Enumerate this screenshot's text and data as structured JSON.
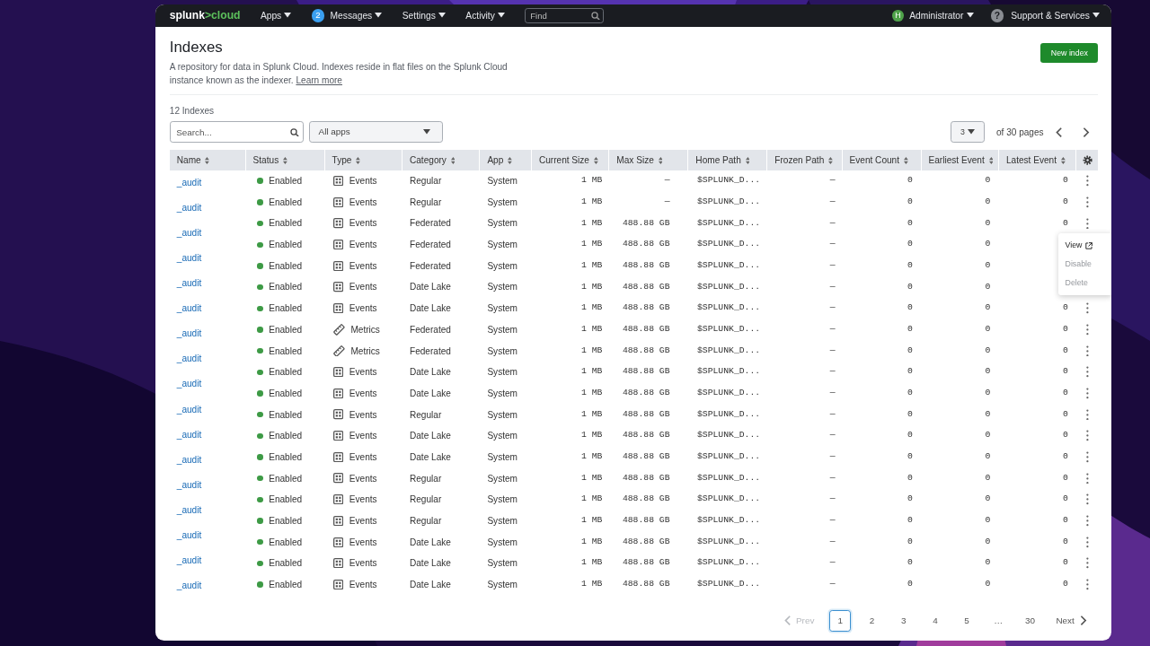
{
  "nav": {
    "logo": [
      "splunk",
      ">cloud"
    ],
    "items": [
      {
        "label": "Apps"
      },
      {
        "label": "Messages",
        "badge": "2"
      },
      {
        "label": "Settings"
      },
      {
        "label": "Activity"
      }
    ],
    "find": {
      "placeholder": "Find"
    },
    "user": {
      "avatar": "H",
      "label": "Administrator"
    },
    "support": {
      "icon": "?",
      "label": "Support & Services"
    }
  },
  "page": {
    "title": "Indexes",
    "description": "A repository for data in Splunk Cloud. Indexes reside in flat files on the Splunk Cloud instance known as the indexer.",
    "learn_more": "Learn more",
    "new_button": "New index"
  },
  "count": "12 Indexes",
  "search": {
    "placeholder": "Search..."
  },
  "app_filter": {
    "value": "All apps"
  },
  "pager_top": {
    "page": "3",
    "of": "of 30 pages"
  },
  "table": {
    "columns": [
      "Name",
      "Status",
      "Type",
      "Category",
      "App",
      "Current Size",
      "Max Size",
      "Home Path",
      "Frozen Path",
      "Event Count",
      "Earliest Event",
      "Latest Event"
    ],
    "names": [
      "_audit",
      "_audit",
      "_audit",
      "_audit",
      "_audit",
      "_audit",
      "_audit",
      "_audit",
      "_audit",
      "_audit",
      "_audit",
      "_audit",
      "_audit",
      "_audit",
      "_audit",
      "_audit",
      "_audit"
    ],
    "row_menu": [
      {
        "label": "View",
        "disabled": false
      },
      {
        "label": "Disable",
        "disabled": true
      },
      {
        "label": "Delete",
        "disabled": true
      }
    ],
    "rows": [
      {
        "status": "Enabled",
        "kind": "events",
        "type": "Events",
        "category": "Regular",
        "app": "System",
        "current_size": "1 MB",
        "max_size": "—",
        "home_path": "$SPLUNK_D...",
        "frozen_path": "—",
        "event_count": "0",
        "earliest": "0",
        "latest": "0",
        "menu_open": false
      },
      {
        "status": "Enabled",
        "kind": "events",
        "type": "Events",
        "category": "Regular",
        "app": "System",
        "current_size": "1 MB",
        "max_size": "—",
        "home_path": "$SPLUNK_D...",
        "frozen_path": "—",
        "event_count": "0",
        "earliest": "0",
        "latest": "0",
        "menu_open": false
      },
      {
        "status": "Enabled",
        "kind": "events",
        "type": "Events",
        "category": "Federated",
        "app": "System",
        "current_size": "1 MB",
        "max_size": "488.88 GB",
        "home_path": "$SPLUNK_D...",
        "frozen_path": "—",
        "event_count": "0",
        "earliest": "0",
        "latest": "0",
        "menu_open": true
      },
      {
        "status": "Enabled",
        "kind": "events",
        "type": "Events",
        "category": "Federated",
        "app": "System",
        "current_size": "1 MB",
        "max_size": "488.88 GB",
        "home_path": "$SPLUNK_D...",
        "frozen_path": "—",
        "event_count": "0",
        "earliest": "0",
        "menu_open": false
      },
      {
        "status": "Enabled",
        "kind": "events",
        "type": "Events",
        "category": "Federated",
        "app": "System",
        "current_size": "1 MB",
        "max_size": "488.88 GB",
        "home_path": "$SPLUNK_D...",
        "frozen_path": "—",
        "event_count": "0",
        "earliest": "0",
        "menu_open": false
      },
      {
        "status": "Enabled",
        "kind": "events",
        "type": "Events",
        "category": "Date Lake",
        "app": "System",
        "current_size": "1 MB",
        "max_size": "488.88 GB",
        "home_path": "$SPLUNK_D...",
        "frozen_path": "—",
        "event_count": "0",
        "earliest": "0",
        "menu_open": false
      },
      {
        "status": "Enabled",
        "kind": "events",
        "type": "Events",
        "category": "Date Lake",
        "app": "System",
        "current_size": "1 MB",
        "max_size": "488.88 GB",
        "home_path": "$SPLUNK_D...",
        "frozen_path": "—",
        "event_count": "0",
        "earliest": "0",
        "latest": "0",
        "menu_open": false
      },
      {
        "status": "Enabled",
        "kind": "metrics",
        "type": "Metrics",
        "category": "Federated",
        "app": "System",
        "current_size": "1 MB",
        "max_size": "488.88 GB",
        "home_path": "$SPLUNK_D...",
        "frozen_path": "—",
        "event_count": "0",
        "earliest": "0",
        "latest": "0",
        "menu_open": false
      },
      {
        "status": "Enabled",
        "kind": "metrics",
        "type": "Metrics",
        "category": "Federated",
        "app": "System",
        "current_size": "1 MB",
        "max_size": "488.88 GB",
        "home_path": "$SPLUNK_D...",
        "frozen_path": "—",
        "event_count": "0",
        "earliest": "0",
        "latest": "0",
        "menu_open": false
      },
      {
        "status": "Enabled",
        "kind": "events",
        "type": "Events",
        "category": "Date Lake",
        "app": "System",
        "current_size": "1 MB",
        "max_size": "488.88 GB",
        "home_path": "$SPLUNK_D...",
        "frozen_path": "—",
        "event_count": "0",
        "earliest": "0",
        "latest": "0",
        "menu_open": false
      },
      {
        "status": "Enabled",
        "kind": "events",
        "type": "Events",
        "category": "Date Lake",
        "app": "System",
        "current_size": "1 MB",
        "max_size": "488.88 GB",
        "home_path": "$SPLUNK_D...",
        "frozen_path": "—",
        "event_count": "0",
        "earliest": "0",
        "latest": "0",
        "menu_open": false
      },
      {
        "status": "Enabled",
        "kind": "events",
        "type": "Events",
        "category": "Regular",
        "app": "System",
        "current_size": "1 MB",
        "max_size": "488.88 GB",
        "home_path": "$SPLUNK_D...",
        "frozen_path": "—",
        "event_count": "0",
        "earliest": "0",
        "latest": "0",
        "menu_open": false
      },
      {
        "status": "Enabled",
        "kind": "events",
        "type": "Events",
        "category": "Date Lake",
        "app": "System",
        "current_size": "1 MB",
        "max_size": "488.88 GB",
        "home_path": "$SPLUNK_D...",
        "frozen_path": "—",
        "event_count": "0",
        "earliest": "0",
        "latest": "0",
        "menu_open": false
      },
      {
        "status": "Enabled",
        "kind": "events",
        "type": "Events",
        "category": "Date Lake",
        "app": "System",
        "current_size": "1 MB",
        "max_size": "488.88 GB",
        "home_path": "$SPLUNK_D...",
        "frozen_path": "—",
        "event_count": "0",
        "earliest": "0",
        "latest": "0",
        "menu_open": false
      },
      {
        "status": "Enabled",
        "kind": "events",
        "type": "Events",
        "category": "Regular",
        "app": "System",
        "current_size": "1 MB",
        "max_size": "488.88 GB",
        "home_path": "$SPLUNK_D...",
        "frozen_path": "—",
        "event_count": "0",
        "earliest": "0",
        "latest": "0",
        "menu_open": false
      },
      {
        "status": "Enabled",
        "kind": "events",
        "type": "Events",
        "category": "Regular",
        "app": "System",
        "current_size": "1 MB",
        "max_size": "488.88 GB",
        "home_path": "$SPLUNK_D...",
        "frozen_path": "—",
        "event_count": "0",
        "earliest": "0",
        "latest": "0",
        "menu_open": false
      },
      {
        "status": "Enabled",
        "kind": "events",
        "type": "Events",
        "category": "Regular",
        "app": "System",
        "current_size": "1 MB",
        "max_size": "488.88 GB",
        "home_path": "$SPLUNK_D...",
        "frozen_path": "—",
        "event_count": "0",
        "earliest": "0",
        "latest": "0",
        "menu_open": false
      },
      {
        "status": "Enabled",
        "kind": "events",
        "type": "Events",
        "category": "Date Lake",
        "app": "System",
        "current_size": "1 MB",
        "max_size": "488.88 GB",
        "home_path": "$SPLUNK_D...",
        "frozen_path": "—",
        "event_count": "0",
        "earliest": "0",
        "latest": "0",
        "menu_open": false
      },
      {
        "status": "Enabled",
        "kind": "events",
        "type": "Events",
        "category": "Date Lake",
        "app": "System",
        "current_size": "1 MB",
        "max_size": "488.88 GB",
        "home_path": "$SPLUNK_D...",
        "frozen_path": "—",
        "event_count": "0",
        "earliest": "0",
        "latest": "0",
        "menu_open": false
      },
      {
        "status": "Enabled",
        "kind": "events",
        "type": "Events",
        "category": "Date Lake",
        "app": "System",
        "current_size": "1 MB",
        "max_size": "488.88 GB",
        "home_path": "$SPLUNK_D...",
        "frozen_path": "—",
        "event_count": "0",
        "earliest": "0",
        "latest": "0",
        "menu_open": false
      }
    ]
  },
  "pagination": {
    "prev": {
      "label": "Prev",
      "disabled": true
    },
    "pages": [
      {
        "label": "1",
        "selected": true
      },
      {
        "label": "2",
        "selected": false
      },
      {
        "label": "3",
        "selected": false
      },
      {
        "label": "4",
        "selected": false
      },
      {
        "label": "5",
        "selected": false
      },
      {
        "label": "…",
        "selected": false
      },
      {
        "label": "30",
        "selected": false
      }
    ],
    "next": {
      "label": "Next",
      "disabled": false
    }
  }
}
